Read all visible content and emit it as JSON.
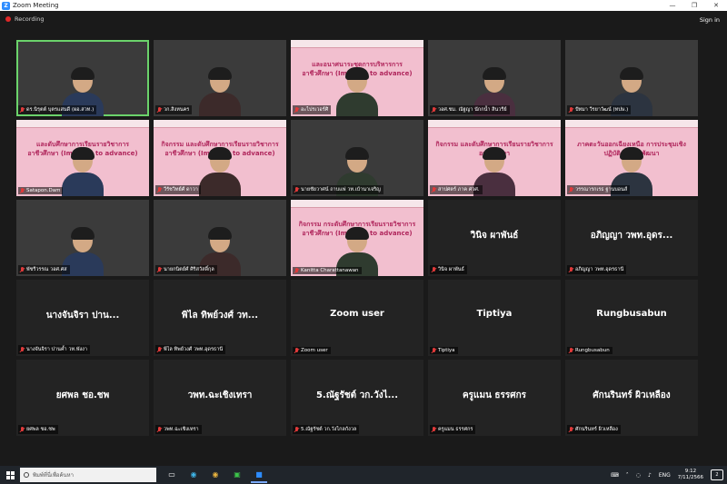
{
  "window": {
    "title": "Zoom Meeting",
    "minimize": "—",
    "maximize": "❐",
    "close": "✕"
  },
  "topbar": {
    "recording_label": "Recording",
    "signin_label": "Sign in"
  },
  "tiles": [
    {
      "name": "ดร.นิรุตต์ บุตรแสนดี (ผอ.สวท.)",
      "kind": "camera",
      "active": true
    },
    {
      "name": "วก.สิงหนคร",
      "kind": "camera"
    },
    {
      "name": "อะไปรเวอร์ศิ",
      "kind": "slide",
      "slide_text": "และอนาศนาระชุดการบริหารการอาชีวศึกษา (Improve to advance)"
    },
    {
      "name": "วอศ.ชม. ณัฐญา นักกน้ำ สินวรีย์",
      "kind": "camera"
    },
    {
      "name": "ปัทมา วีรยาวัฒน์ (ทปษ.)",
      "kind": "camera"
    },
    {
      "name": "Satapon.Dam",
      "kind": "slide",
      "slide_text": "และดับศึกษาการเรียนรายวิชาการอาชีวศึกษา (Improve to advance)"
    },
    {
      "name": "วีรัชวิทย์ศ์ ดาวา",
      "kind": "slide",
      "slide_text": "กิจกรรม และดับศึกษาการเรียนรายวิชาการอาชีวศึกษา (Improve to advance)"
    },
    {
      "name": "นายชัยวาศน์ ถาบแฟ วท.เบ้านาเจริญ",
      "kind": "camera"
    },
    {
      "name": "สาปศตร์ ภาค ศวศ.",
      "kind": "slide",
      "slide_text": "กิจกรรม และดับศึกษาการเรียนรายวิชาการอาชีวศึกษา"
    },
    {
      "name": "วรรณารกเรธ ฐานบอนส์",
      "kind": "slide",
      "slide_text": "ภาคตะวันออกเฉียงเหนือ การประชุมเชิงปฏิบัติการเพื่อพัฒนา"
    },
    {
      "name": "พัชรีวรรณ วอศ.ศส",
      "kind": "camera"
    },
    {
      "name": "นายกนิตย์ศ์ ศิริสวัสดิ์กุล",
      "kind": "camera"
    },
    {
      "name": "Kanitta Charattanawan",
      "kind": "slide",
      "slide_text": "กิจกรรม กระดับศึกษาการเรียนรายวิชาการอาชีวศึกษา (Improve to advance)"
    },
    {
      "name": "วินิจ ผาพันธ์",
      "kind": "avatar",
      "display": "วินิจ ผาพันธ์"
    },
    {
      "name": "อภิญญา วพท.อุดรธานี",
      "kind": "avatar",
      "display": "อภิญญา วพท.อุดร..."
    },
    {
      "name": "นางจันจิรา ปานค้ำ วท.พังงา",
      "kind": "avatar",
      "display": "นางจันจิรา ปาน..."
    },
    {
      "name": "พิไล ทิพย์วงศ์ วพท.อุดรธานี",
      "kind": "avatar",
      "display": "พิไล ทิพย์วงศ์ วท..."
    },
    {
      "name": "Zoom user",
      "kind": "avatar",
      "display": "Zoom user"
    },
    {
      "name": "Tiptiya",
      "kind": "avatar",
      "display": "Tiptiya"
    },
    {
      "name": "Rungbusabun",
      "kind": "avatar",
      "display": "Rungbusabun"
    },
    {
      "name": "ยศพล ชอ.ชพ",
      "kind": "avatar",
      "display": "ยศพล ชอ.ชพ"
    },
    {
      "name": "วพท.ฉะเชิงเทรา",
      "kind": "avatar",
      "display": "วพท.ฉะเชิงเทรา"
    },
    {
      "name": "5.ณัฐรัชต์ วก.วังไกลกังวล",
      "kind": "avatar",
      "display": "5.ณัฐรัชต์ วก.วังไ..."
    },
    {
      "name": "ครูแมน ธรรศกร",
      "kind": "avatar",
      "display": "ครูแมน ธรรศกร"
    },
    {
      "name": "ศักนรินทร์ ผิวเหลือง",
      "kind": "avatar",
      "display": "ศักนรินทร์ ผิวเหลือง"
    }
  ],
  "taskbar": {
    "search_placeholder": "พิมพ์ที่นี่เพื่อค้นหา",
    "apps": [
      "task-view",
      "edge",
      "chrome",
      "line",
      "zoom"
    ],
    "lang": "ENG",
    "time": "9:12",
    "date": "7/11/2566",
    "notif_count": "2"
  },
  "colors": {
    "slide_pink": "#f2bfcf",
    "slide_title": "#b0265c",
    "active_border": "#6bd36b",
    "record": "#e02828"
  }
}
